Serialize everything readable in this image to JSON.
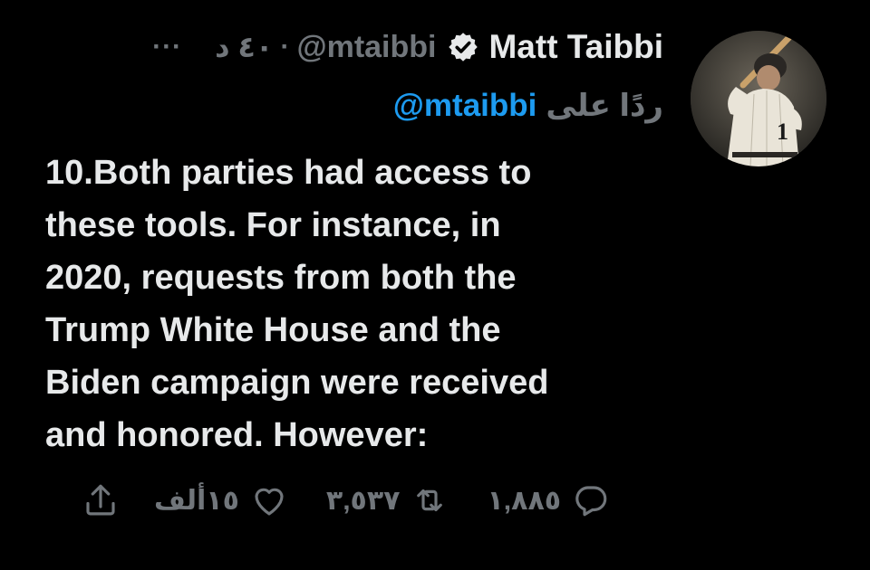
{
  "tweet": {
    "author_name": "Matt Taibbi",
    "author_handle": "@mtaibbi",
    "separator": "·",
    "time": "٤٠ د",
    "more": "···",
    "reply_label": "ردًا على",
    "reply_handle": "@mtaibbi",
    "text": "10.Both parties had access to\nthese tools. For instance, in\n2020, requests from both the\nTrump White House and the\nBiden campaign were received\nand honored. However:",
    "replies": "١,٨٨٥",
    "retweets": "٣,٥٣٧",
    "likes": "١٥ألف"
  },
  "icons": {
    "verified": "verified-badge-icon",
    "reply": "reply-icon",
    "retweet": "retweet-icon",
    "like": "heart-icon",
    "share": "share-icon",
    "more": "more-icon"
  },
  "colors": {
    "background": "#000000",
    "text": "#e7e9ea",
    "secondary": "#71767b",
    "link": "#1d9bf0"
  }
}
